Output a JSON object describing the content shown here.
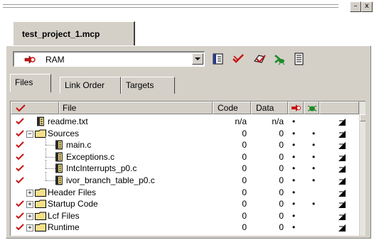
{
  "window": {
    "minimize_label": "–",
    "close_label": "x"
  },
  "project": {
    "tab_label": "test_project_1.mcp"
  },
  "target": {
    "selected": "RAM"
  },
  "toolbar": {
    "icons": [
      "target-settings-icon",
      "synchronize-icon",
      "make-icon",
      "debug-icon",
      "project-inspector-icon"
    ]
  },
  "view_tabs": [
    {
      "label": "Files"
    },
    {
      "label": "Link Order"
    },
    {
      "label": "Targets"
    }
  ],
  "columns": {
    "touch": "",
    "file": "File",
    "code": "Code",
    "data": "Data"
  },
  "files": [
    {
      "name": "readme.txt",
      "kind": "file",
      "level": 0,
      "expander": "",
      "checked": true,
      "code": "n/a",
      "data": "n/a",
      "debug": "•",
      "target": ""
    },
    {
      "name": "Sources",
      "kind": "folder",
      "level": 0,
      "expander": "−",
      "checked": true,
      "code": "0",
      "data": "0",
      "debug": "•",
      "target": "•"
    },
    {
      "name": "main.c",
      "kind": "file",
      "level": 1,
      "expander": "",
      "checked": true,
      "code": "0",
      "data": "0",
      "debug": "•",
      "target": "•"
    },
    {
      "name": "Exceptions.c",
      "kind": "file",
      "level": 1,
      "expander": "",
      "checked": true,
      "code": "0",
      "data": "0",
      "debug": "•",
      "target": "•"
    },
    {
      "name": "IntcInterrupts_p0.c",
      "kind": "file",
      "level": 1,
      "expander": "",
      "checked": true,
      "code": "0",
      "data": "0",
      "debug": "•",
      "target": "•"
    },
    {
      "name": "ivor_branch_table_p0.c",
      "kind": "file",
      "level": 1,
      "expander": "",
      "checked": true,
      "code": "0",
      "data": "0",
      "debug": "•",
      "target": "•"
    },
    {
      "name": "Header Files",
      "kind": "folder",
      "level": 0,
      "expander": "+",
      "checked": false,
      "code": "0",
      "data": "0",
      "debug": "•",
      "target": ""
    },
    {
      "name": "Startup Code",
      "kind": "folder",
      "level": 0,
      "expander": "+",
      "checked": true,
      "code": "0",
      "data": "0",
      "debug": "•",
      "target": "•"
    },
    {
      "name": "Lcf Files",
      "kind": "folder",
      "level": 0,
      "expander": "+",
      "checked": true,
      "code": "0",
      "data": "0",
      "debug": "•",
      "target": ""
    },
    {
      "name": "Runtime",
      "kind": "folder",
      "level": 0,
      "expander": "+",
      "checked": true,
      "code": "0",
      "data": "0",
      "debug": "•",
      "target": ""
    }
  ],
  "colors": {
    "face": "#d4d0c8",
    "checkmark": "#c81010",
    "folder": "#f4e08a",
    "debug_green": "#1f8a2a"
  }
}
